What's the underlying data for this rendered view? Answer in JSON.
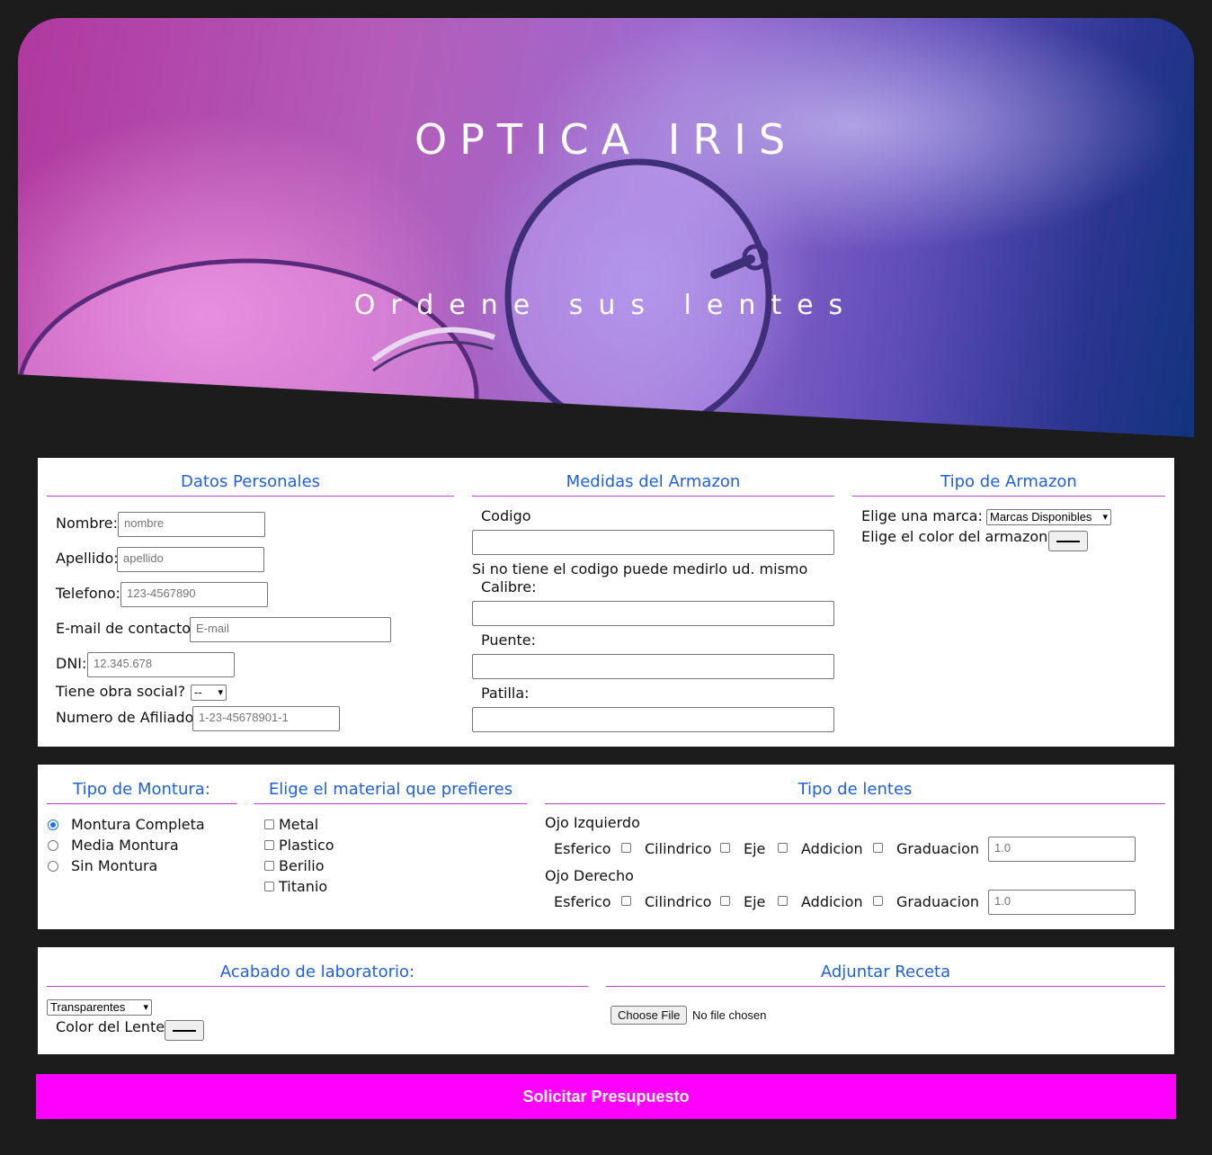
{
  "hero": {
    "title": "OPTICA IRIS",
    "subtitle": "Ordene sus lentes"
  },
  "datos_personales": {
    "title": "Datos Personales",
    "nombre_label": "Nombre:",
    "nombre_placeholder": "nombre",
    "apellido_label": "Apellido:",
    "apellido_placeholder": "apellido",
    "telefono_label": "Telefono:",
    "telefono_placeholder": "123-4567890",
    "email_label": "E-mail de contacto:",
    "email_placeholder": "E-mail",
    "dni_label": "DNI:",
    "dni_placeholder": "12.345.678",
    "obra_social_label": "Tiene obra social?",
    "obra_social_value": "--",
    "afiliado_label": "Numero de Afiliado:",
    "afiliado_placeholder": "1-23-45678901-1"
  },
  "medidas": {
    "title": "Medidas del Armazon",
    "codigo_label": "Codigo",
    "hint": "Si no tiene el codigo puede medirlo ud. mismo",
    "calibre_label": "Calibre:",
    "puente_label": "Puente:",
    "patilla_label": "Patilla:"
  },
  "tipo_armazon": {
    "title": "Tipo de Armazon",
    "marca_label": "Elige una marca:",
    "marca_value": "Marcas Disponibles",
    "color_label": "Elige el color del armazon",
    "color_value": "#000000"
  },
  "montura": {
    "title": "Tipo de Montura:",
    "options": [
      "Montura Completa",
      "Media Montura",
      "Sin Montura"
    ],
    "selected": "Montura Completa"
  },
  "material": {
    "title": "Elige el material que prefieres",
    "options": [
      "Metal",
      "Plastico",
      "Berilio",
      "Titanio"
    ]
  },
  "lentes": {
    "title": "Tipo de lentes",
    "izq_label": "Ojo Izquierdo",
    "der_label": "Ojo Derecho",
    "esferico": "Esferico",
    "cilindrico": "Cilindrico",
    "eje": "Eje",
    "addicion": "Addicion",
    "graduacion": "Graduacion",
    "graduacion_placeholder": "1.0"
  },
  "acabado": {
    "title": "Acabado de laboratorio:",
    "value": "Transparentes",
    "color_label": "Color del Lente:",
    "color_value": "#000000"
  },
  "receta": {
    "title": "Adjuntar Receta",
    "button": "Choose File",
    "status": "No file chosen"
  },
  "submit_label": "Solicitar Presupuesto",
  "colors": {
    "accent_heading": "#1f5fe0",
    "divider": "#c23ad4",
    "submit_bg": "#ff00ff",
    "page_bg": "#1c1c1c"
  }
}
